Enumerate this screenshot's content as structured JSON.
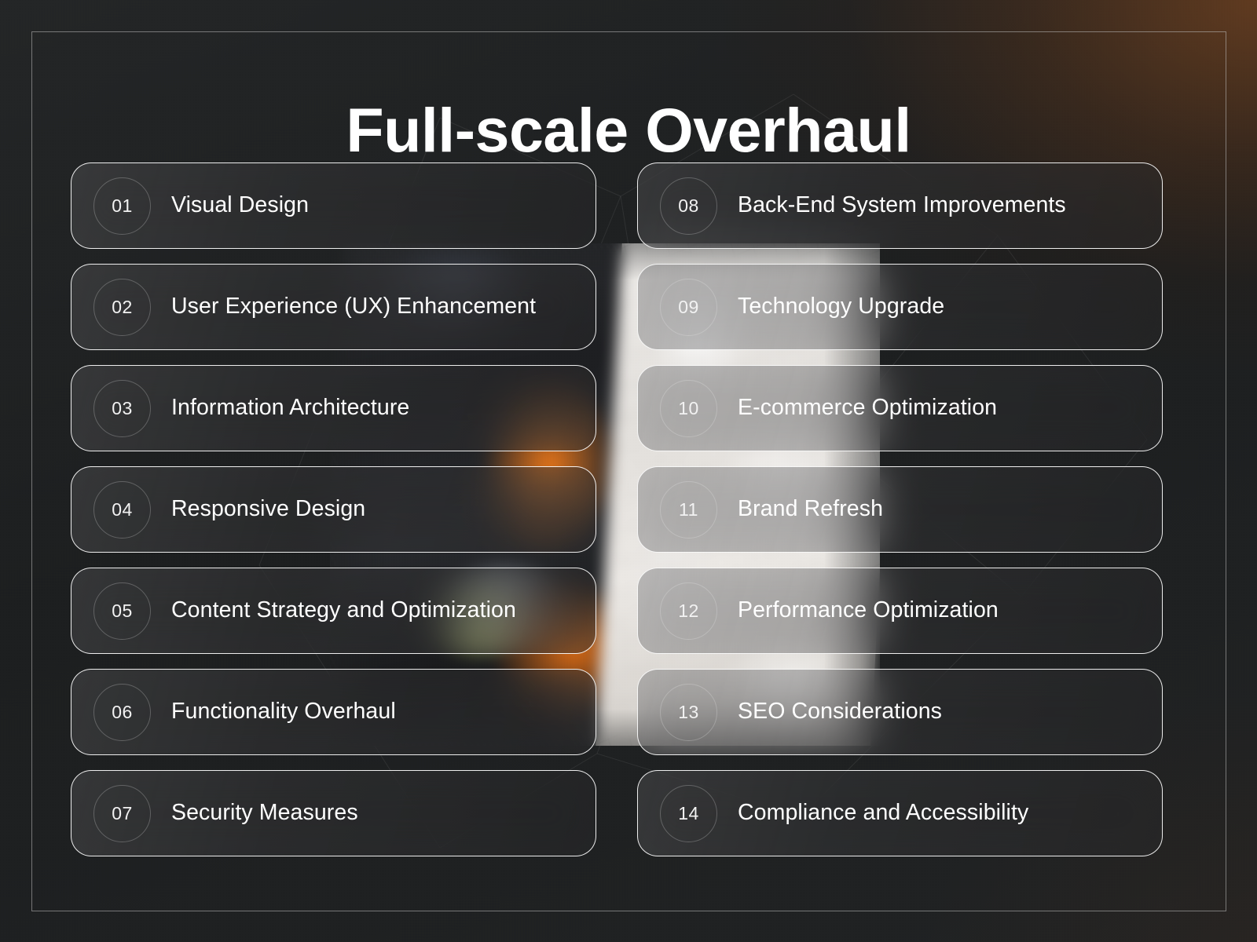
{
  "title": "Full-scale Overhaul",
  "colors": {
    "background": "#202223",
    "accent_glow": "#96501e",
    "card_border": "#ffffff",
    "text": "#ffffff",
    "badge_border": "#ebebeb",
    "photo_orange": "#ff7e16"
  },
  "columns": [
    {
      "name": "left-column",
      "items": [
        {
          "number": "01",
          "label": "Visual Design"
        },
        {
          "number": "02",
          "label": "User Experience (UX) Enhancement"
        },
        {
          "number": "03",
          "label": "Information Architecture"
        },
        {
          "number": "04",
          "label": "Responsive Design"
        },
        {
          "number": "05",
          "label": "Content Strategy and Optimization"
        },
        {
          "number": "06",
          "label": "Functionality Overhaul"
        },
        {
          "number": "07",
          "label": "Security Measures"
        }
      ]
    },
    {
      "name": "right-column",
      "items": [
        {
          "number": "08",
          "label": "Back-End System Improvements"
        },
        {
          "number": "09",
          "label": "Technology Upgrade"
        },
        {
          "number": "10",
          "label": "E-commerce Optimization"
        },
        {
          "number": "11",
          "label": "Brand Refresh"
        },
        {
          "number": "12",
          "label": "Performance Optimization"
        },
        {
          "number": "13",
          "label": "SEO Considerations"
        },
        {
          "number": "14",
          "label": "Compliance and Accessibility"
        }
      ]
    }
  ]
}
